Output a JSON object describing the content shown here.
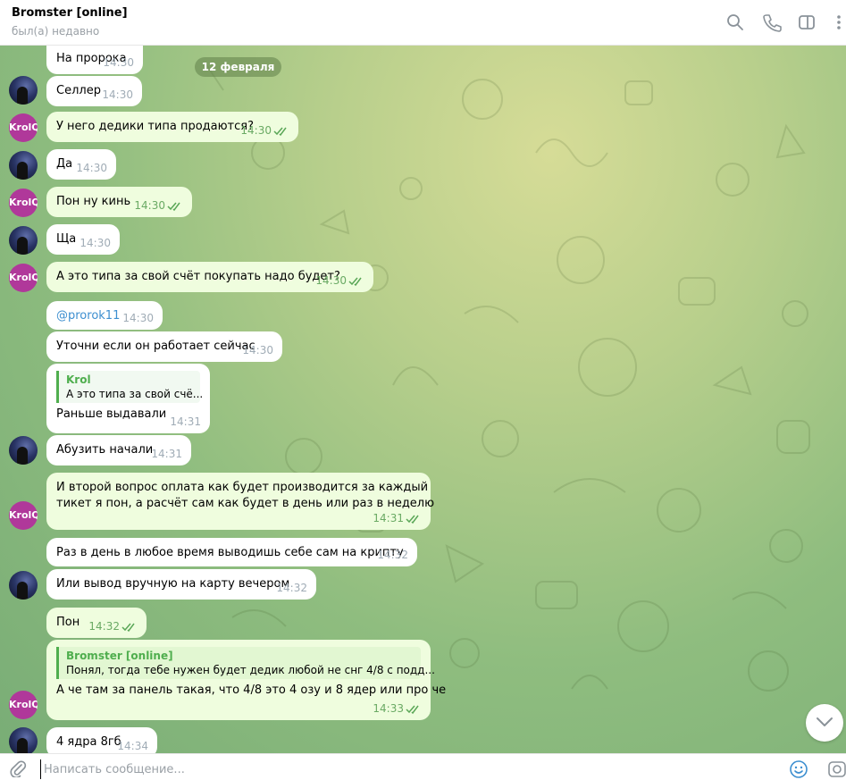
{
  "header": {
    "name": "Bromster [online]",
    "status": "был(а) недавно",
    "icons": [
      "search-icon",
      "phone-icon",
      "sidebar-icon",
      "more-icon"
    ]
  },
  "date_separator": "12 февраля",
  "colors": {
    "incoming_bubble": "#ffffff",
    "outgoing_bubble": "#effdde",
    "accent_green": "#4fae4e",
    "link_blue": "#3d8fd0",
    "krol_avatar": "#b0389a"
  },
  "avatars": {
    "krol_label": "KrolQ"
  },
  "messages": [
    {
      "text": "На пророка",
      "time": "14:30"
    },
    {
      "text": "Селлер",
      "time": "14:30"
    },
    {
      "text": "У него дедики типа продаются?",
      "time": "14:30"
    },
    {
      "text": "Да",
      "time": "14:30"
    },
    {
      "text": "Пон ну кинь",
      "time": "14:30"
    },
    {
      "text": "Ща",
      "time": "14:30"
    },
    {
      "text": "А это типа за свой счёт покупать надо будет?",
      "time": "14:30"
    },
    {
      "text": "@prorok11",
      "time": "14:30"
    },
    {
      "text": "Уточни если он работает сейчас",
      "time": "14:30"
    },
    {
      "quote_name": "Krol",
      "quote_text": "А это типа за свой счё...",
      "text": "Раньше выдавали",
      "time": "14:31"
    },
    {
      "text": "Абузить начали",
      "time": "14:31"
    },
    {
      "line1": "И второй вопрос оплата как будет производится за каждый",
      "line2": "тикет я пон, а расчёт сам как будет в день или раз в неделю",
      "time": "14:31"
    },
    {
      "text": "Раз в день в любое время выводишь себе сам на крипту",
      "time": "14:32"
    },
    {
      "text": "Или вывод вручную на карту вечером",
      "time": "14:32"
    },
    {
      "text": "Пон",
      "time": "14:32"
    },
    {
      "quote_name": "Bromster [online]",
      "quote_text": "Понял, тогда тебе нужен будет дедик любой не снг 4/8 с подд...",
      "text": "А че там за панель такая, что 4/8 это 4 озу и 8 ядер или про че",
      "time": "14:33"
    },
    {
      "text": "4 ядра 8гб",
      "time": "14:34"
    }
  ],
  "composer": {
    "placeholder": "Написать сообщение..."
  }
}
